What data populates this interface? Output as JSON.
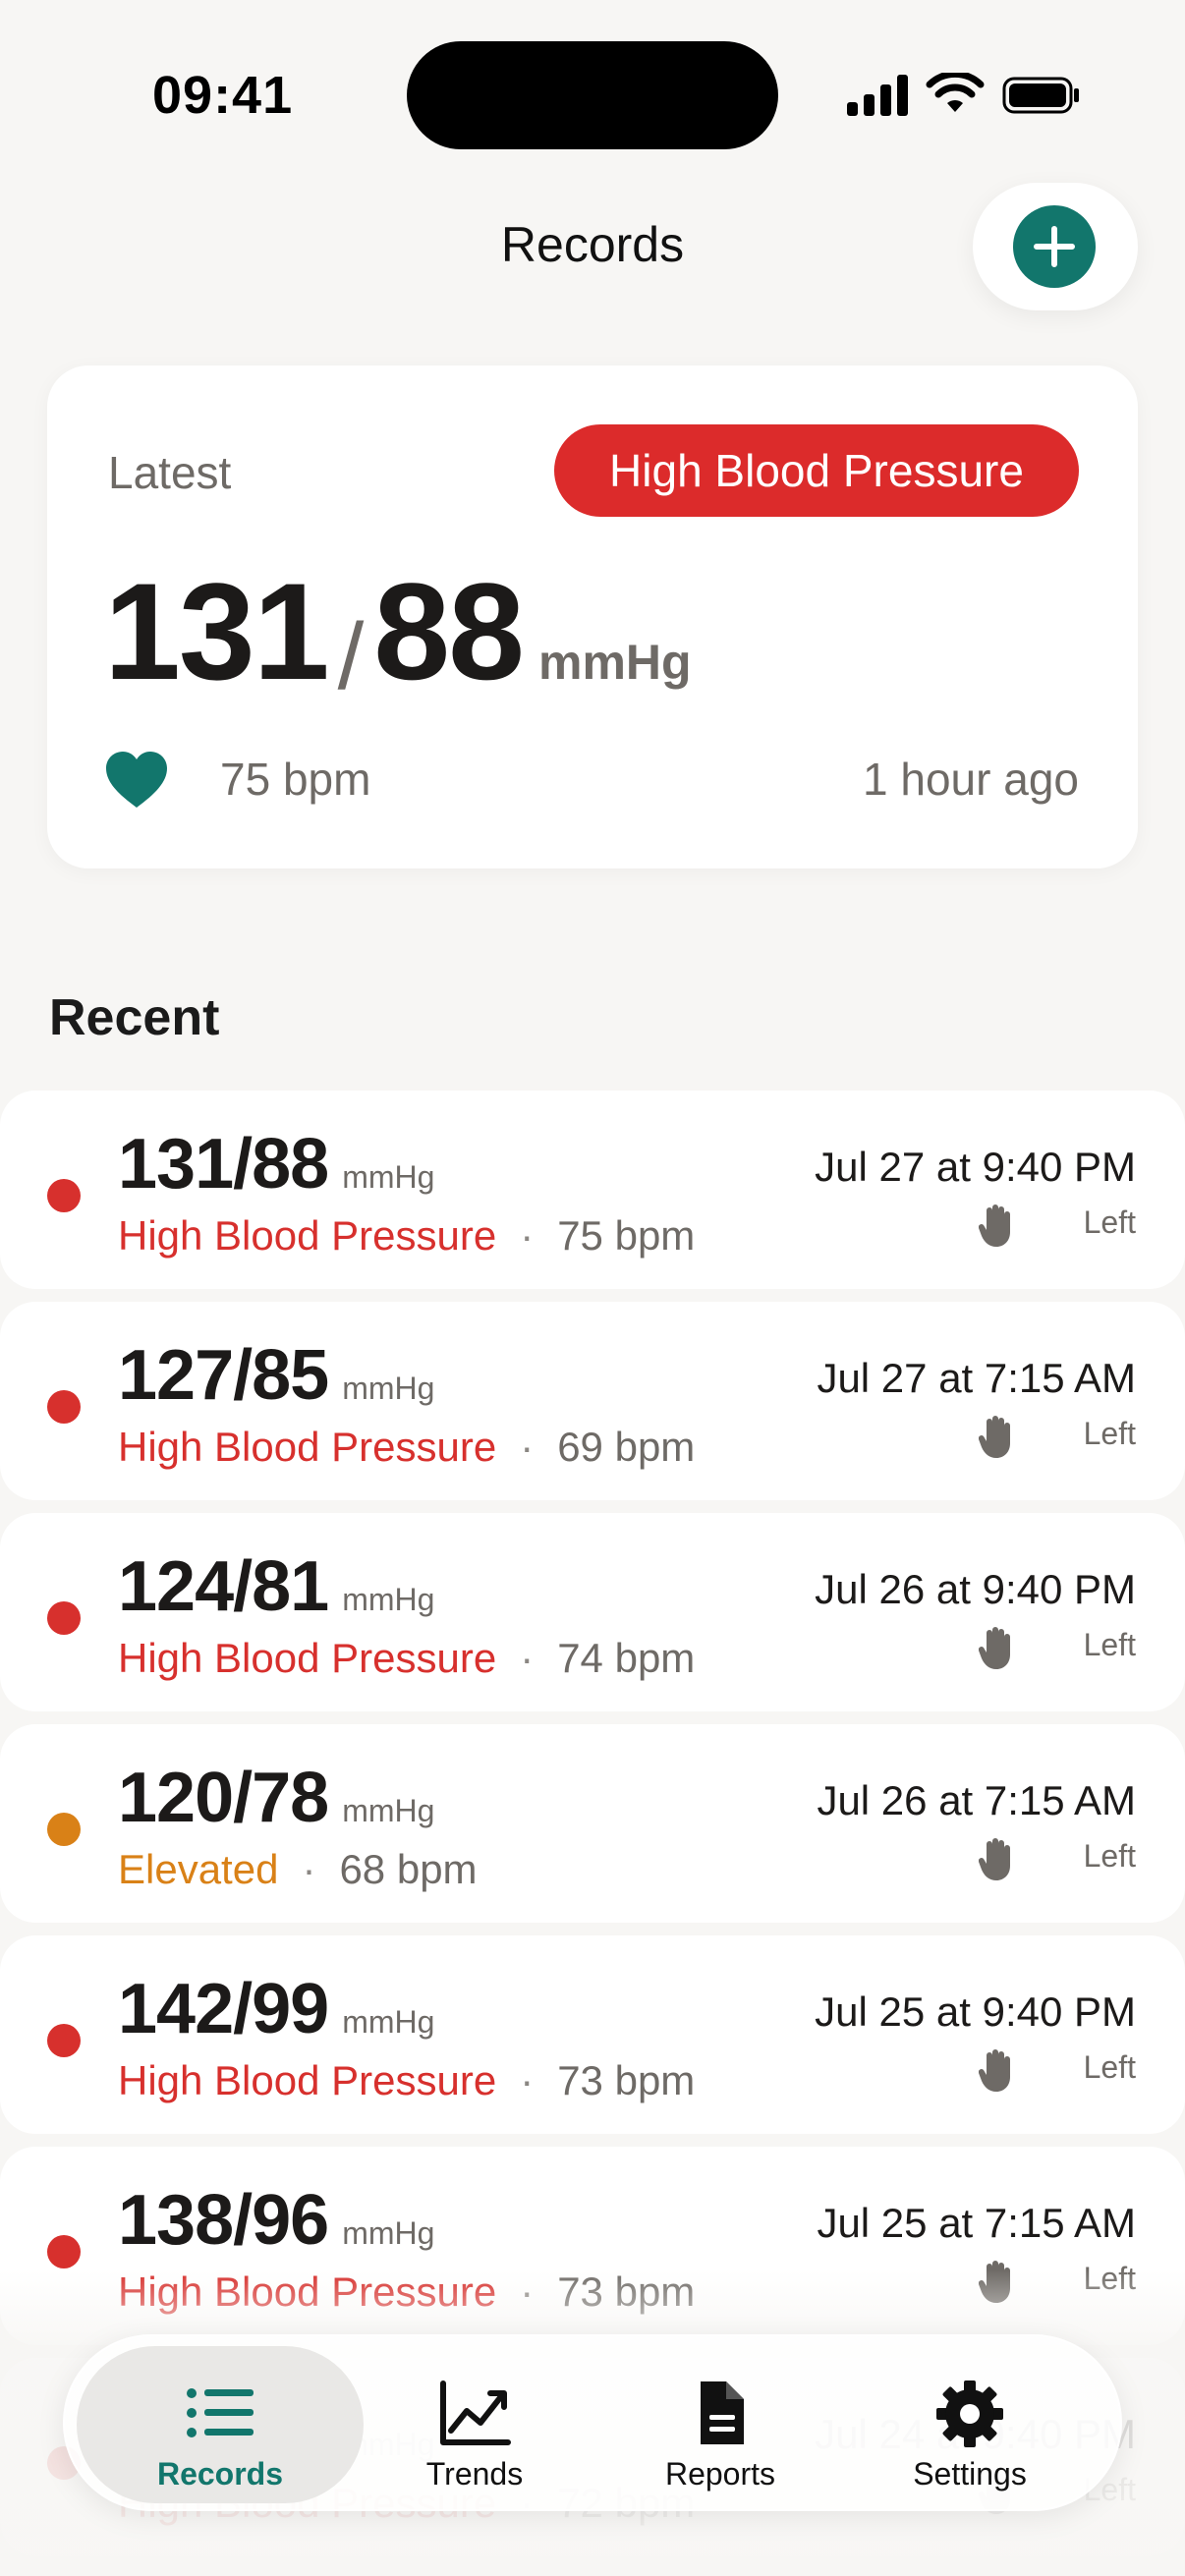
{
  "status_bar": {
    "time": "09:41"
  },
  "header": {
    "title": "Records"
  },
  "latest": {
    "label": "Latest",
    "badge": "High Blood Pressure",
    "systolic": "131",
    "slash": "/",
    "diastolic": "88",
    "unit": "mmHg",
    "bpm": "75 bpm",
    "time_ago": "1 hour ago"
  },
  "recent": {
    "title": "Recent",
    "separator": "·",
    "rows": [
      {
        "value": "131/88",
        "unit": "mmHg",
        "status": "High Blood Pressure",
        "status_color": "#d7302d",
        "bpm": "75 bpm",
        "date": "Jul 27 at 9:40 PM",
        "side": "Left"
      },
      {
        "value": "127/85",
        "unit": "mmHg",
        "status": "High Blood Pressure",
        "status_color": "#d7302d",
        "bpm": "69 bpm",
        "date": "Jul 27 at 7:15 AM",
        "side": "Left"
      },
      {
        "value": "124/81",
        "unit": "mmHg",
        "status": "High Blood Pressure",
        "status_color": "#d7302d",
        "bpm": "74 bpm",
        "date": "Jul 26 at 9:40 PM",
        "side": "Left"
      },
      {
        "value": "120/78",
        "unit": "mmHg",
        "status": "Elevated",
        "status_color": "#d98117",
        "bpm": "68 bpm",
        "date": "Jul 26 at 7:15 AM",
        "side": "Left"
      },
      {
        "value": "142/99",
        "unit": "mmHg",
        "status": "High Blood Pressure",
        "status_color": "#d7302d",
        "bpm": "73 bpm",
        "date": "Jul 25 at 9:40 PM",
        "side": "Left"
      },
      {
        "value": "138/96",
        "unit": "mmHg",
        "status": "High Blood Pressure",
        "status_color": "#d7302d",
        "bpm": "73 bpm",
        "date": "Jul 25 at 7:15 AM",
        "side": "Left"
      },
      {
        "value": "133/91",
        "unit": "mmHg",
        "status": "High Blood Pressure",
        "status_color": "#d7302d",
        "bpm": "72 bpm",
        "date": "Jul 24 at 9:40 PM",
        "side": "Left"
      }
    ]
  },
  "tab_bar": {
    "tabs": [
      {
        "label": "Records",
        "icon": "list-icon",
        "active": true
      },
      {
        "label": "Trends",
        "icon": "chart-line-icon",
        "active": false
      },
      {
        "label": "Reports",
        "icon": "document-icon",
        "active": false
      },
      {
        "label": "Settings",
        "icon": "gear-icon",
        "active": false
      }
    ]
  },
  "colors": {
    "accent": "#12766c",
    "high": "#d7302d",
    "elevated": "#d98117",
    "badge_bg": "#dc2b2b",
    "secondary_text": "#6e6a66",
    "background": "#f7f6f4"
  }
}
